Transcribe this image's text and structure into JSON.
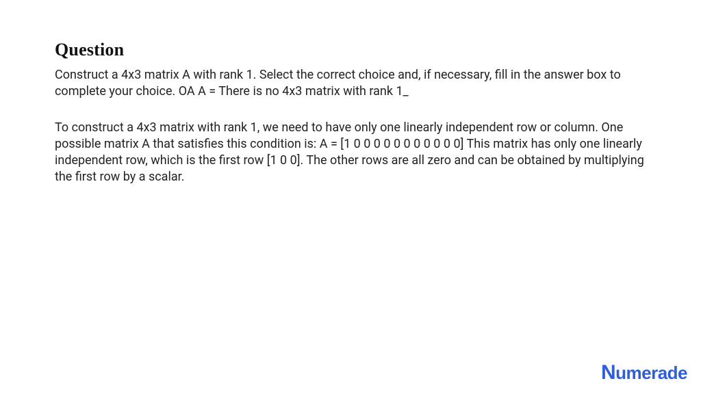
{
  "heading": "Question",
  "question_text": "Construct a 4x3 matrix A with rank 1. Select the correct choice and, if necessary, fill in the answer box to complete your choice. OA A = There is no 4x3 matrix with rank 1_",
  "answer_text": "To construct a 4x3 matrix with rank 1, we need to have only one linearly independent row or column. One possible matrix A that satisfies this condition is: A = [1 0 0 0 0 0 0 0 0 0 0 0] This matrix has only one linearly independent row, which is the first row [1 0 0]. The other rows are all zero and can be obtained by multiplying the first row by a scalar.",
  "brand": {
    "name": "Numerade",
    "color": "#2e5fd8"
  }
}
